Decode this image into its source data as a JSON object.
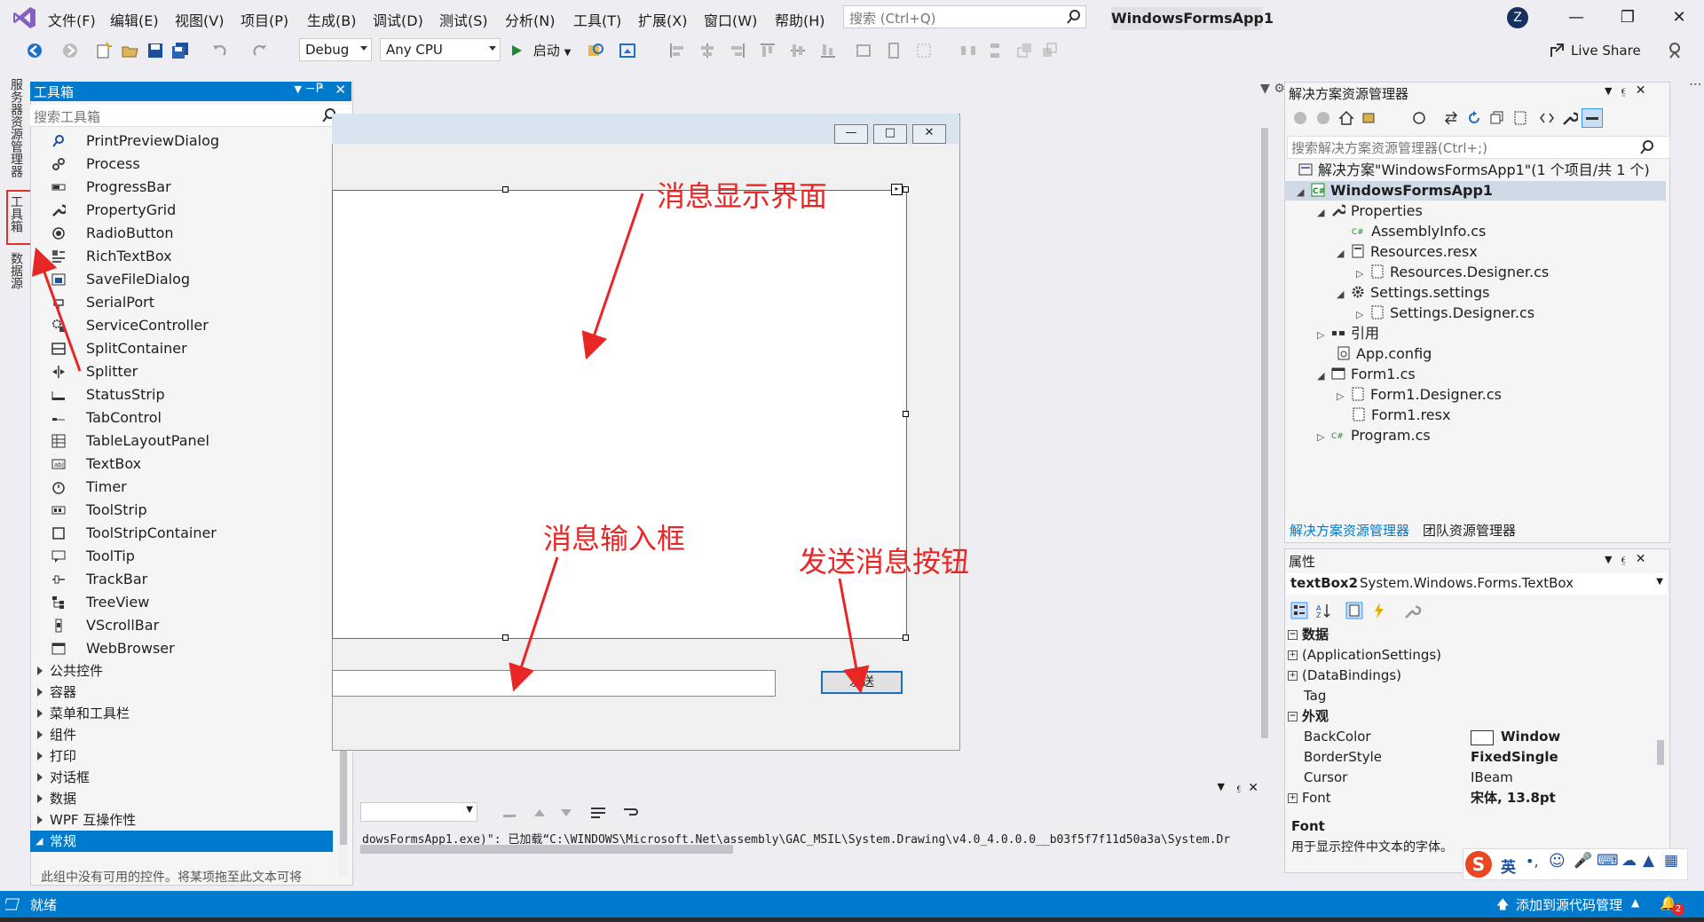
{
  "menu": {
    "items": [
      "文件(F)",
      "编辑(E)",
      "视图(V)",
      "项目(P)",
      "生成(B)",
      "调试(D)",
      "测试(S)",
      "分析(N)",
      "工具(T)",
      "扩展(X)",
      "窗口(W)",
      "帮助(H)"
    ]
  },
  "search": {
    "placeholder": "搜索 (Ctrl+Q)"
  },
  "window": {
    "title": "WindowsFormsApp1",
    "avatar_initial": "Z"
  },
  "toolbar": {
    "config": "Debug",
    "platform": "Any CPU",
    "start_label": "启动",
    "liveshare_label": "Live Share"
  },
  "left_tabs": {
    "server_explorer": "服务器资源管理器",
    "toolbox": "工具箱",
    "data_sources": "数据源"
  },
  "toolbox": {
    "title": "工具箱",
    "search_placeholder": "搜索工具箱",
    "items": [
      "PrintPreviewDialog",
      "Process",
      "ProgressBar",
      "PropertyGrid",
      "RadioButton",
      "RichTextBox",
      "SaveFileDialog",
      "SerialPort",
      "ServiceController",
      "SplitContainer",
      "Splitter",
      "StatusStrip",
      "TabControl",
      "TableLayoutPanel",
      "TextBox",
      "Timer",
      "ToolStrip",
      "ToolStripContainer",
      "ToolTip",
      "TrackBar",
      "TreeView",
      "VScrollBar",
      "WebBrowser"
    ],
    "categories": [
      "公共控件",
      "容器",
      "菜单和工具栏",
      "组件",
      "打印",
      "对话框",
      "数据",
      "WPF 互操作性"
    ],
    "selected_category": "常规",
    "empty_hint": "此组中没有可用的控件。将某项拖至此文本可将"
  },
  "designer": {
    "send_button": "发送",
    "annotations": {
      "display": "消息显示界面",
      "input": "消息输入框",
      "send": "发送消息按钮"
    }
  },
  "output": {
    "text": "dowsFormsApp1.exe)\": 已加载“C:\\WINDOWS\\Microsoft.Net\\assembly\\GAC_MSIL\\System.Drawing\\v4.0_4.0.0.0__b03f5f7f11d50a3a\\System.Dr"
  },
  "solution_explorer": {
    "title": "解决方案资源管理器",
    "search_placeholder": "搜索解决方案资源管理器(Ctrl+;)",
    "tree": [
      {
        "label": "解决方案\"WindowsFormsApp1\"(1 个项目/共 1 个)",
        "icon": "solution-icon"
      },
      {
        "label": "WindowsFormsApp1",
        "icon": "csharp-project-icon"
      },
      {
        "label": "Properties",
        "icon": "wrench-icon"
      },
      {
        "label": "AssemblyInfo.cs",
        "icon": "csharp-file-icon"
      },
      {
        "label": "Resources.resx",
        "icon": "resx-icon"
      },
      {
        "label": "Resources.Designer.cs",
        "icon": "designer-file-icon"
      },
      {
        "label": "Settings.settings",
        "icon": "gear-icon"
      },
      {
        "label": "Settings.Designer.cs",
        "icon": "designer-file-icon"
      },
      {
        "label": "引用",
        "icon": "references-icon"
      },
      {
        "label": "App.config",
        "icon": "config-icon"
      },
      {
        "label": "Form1.cs",
        "icon": "form-icon"
      },
      {
        "label": "Form1.Designer.cs",
        "icon": "designer-file-icon"
      },
      {
        "label": "Form1.resx",
        "icon": "resx-icon"
      },
      {
        "label": "Program.cs",
        "icon": "csharp-file-icon"
      }
    ],
    "tabs": [
      "解决方案资源管理器",
      "团队资源管理器"
    ]
  },
  "properties": {
    "title": "属性",
    "object_name": "textBox2",
    "object_type": "System.Windows.Forms.TextBox",
    "rows": [
      {
        "name": "数据",
        "value": ""
      },
      {
        "name": "(ApplicationSettings)",
        "value": ""
      },
      {
        "name": "(DataBindings)",
        "value": ""
      },
      {
        "name": "Tag",
        "value": ""
      },
      {
        "name": "外观",
        "value": ""
      },
      {
        "name": "BackColor",
        "value": "Window"
      },
      {
        "name": "BorderStyle",
        "value": "FixedSingle"
      },
      {
        "name": "Cursor",
        "value": "IBeam"
      },
      {
        "name": "Font",
        "value": "宋体, 13.8pt"
      }
    ],
    "desc_title": "Font",
    "desc_text": "用于显示控件中文本的字体。"
  },
  "ime": {
    "mode": "英"
  },
  "status": {
    "ready": "就绪",
    "source_control": "添加到源代码管理",
    "notification_count": "2"
  },
  "colors": {
    "accent": "#007acc",
    "annotation": "#e82626"
  }
}
